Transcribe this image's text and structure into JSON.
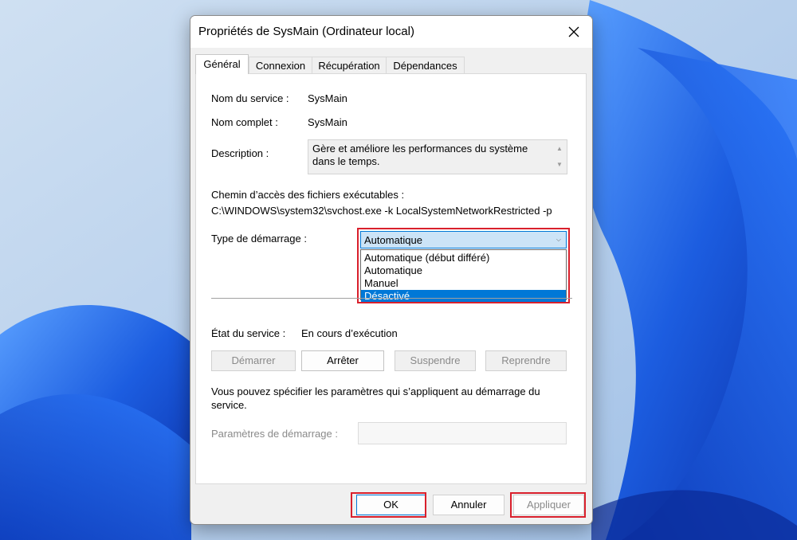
{
  "window": {
    "title": "Propriétés de SysMain (Ordinateur local)"
  },
  "tabs": [
    {
      "label": "Général",
      "active": true
    },
    {
      "label": "Connexion",
      "active": false
    },
    {
      "label": "Récupération",
      "active": false
    },
    {
      "label": "Dépendances",
      "active": false
    }
  ],
  "general": {
    "service_name_label": "Nom du service :",
    "service_name": "SysMain",
    "display_name_label": "Nom complet :",
    "display_name": "SysMain",
    "description_label": "Description :",
    "description": "Gère et améliore les performances du système dans le temps.",
    "path_label": "Chemin d’accès des fichiers exécutables :",
    "path": "C:\\WINDOWS\\system32\\svchost.exe -k LocalSystemNetworkRestricted -p",
    "startup_type_label": "Type de démarrage :",
    "startup_type_selected": "Automatique",
    "startup_options": [
      "Automatique (début différé)",
      "Automatique",
      "Manuel",
      "Désactivé"
    ],
    "highlighted_option": "Désactivé",
    "status_label": "État du service :",
    "status": "En cours d’exécution",
    "buttons": {
      "start": "Démarrer",
      "stop": "Arrêter",
      "pause": "Suspendre",
      "resume": "Reprendre"
    },
    "params_help": "Vous pouvez spécifier les paramètres qui s’appliquent au démarrage du service.",
    "params_label": "Paramètres de démarrage :",
    "params_value": ""
  },
  "footer": {
    "ok": "OK",
    "cancel": "Annuler",
    "apply": "Appliquer"
  },
  "colors": {
    "highlight_box": "#d9202c",
    "selection": "#0078d7",
    "combo_fill": "#cce4f7"
  }
}
